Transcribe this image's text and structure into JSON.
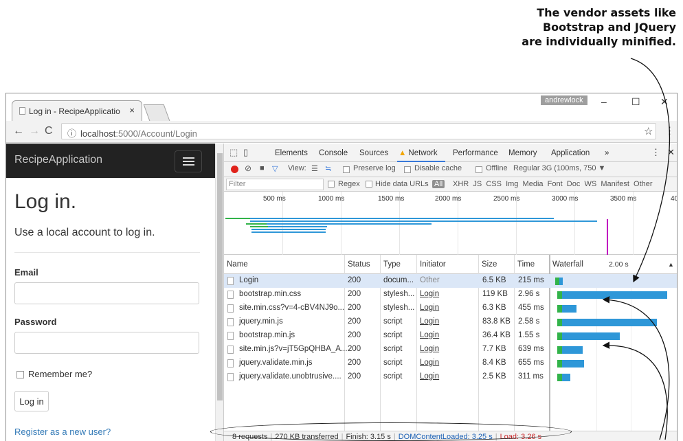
{
  "annotation": {
    "line1": "The vendor assets like",
    "line2": "Bootstrap and JQuery",
    "line3": "are individually minified."
  },
  "browser": {
    "tab_title": "Log in - RecipeApplicatio",
    "tab_close": "×",
    "user_badge": "andrewlock",
    "minimize": "–",
    "maximize": "☐",
    "close": "✕",
    "url_host": "localhost",
    "url_path": ":5000/Account/Login",
    "info_icon": "ⓘ",
    "star_icon": "☆",
    "menu_icon": "⋮"
  },
  "page": {
    "brand": "RecipeApplication",
    "heading": "Log in.",
    "lead": "Use a local account to log in.",
    "email_label": "Email",
    "password_label": "Password",
    "remember_label": "Remember me?",
    "login_button": "Log in",
    "register_link": "Register as a new user?"
  },
  "devtools": {
    "tabs": [
      "Elements",
      "Console",
      "Sources",
      "Network",
      "Performance",
      "Memory",
      "Application"
    ],
    "more_tabs": "»",
    "selected_tab": "Network",
    "view_label": "View:",
    "preserve_log": "Preserve log",
    "disable_cache": "Disable cache",
    "offline": "Offline",
    "throttle": "Regular 3G (100ms, 750",
    "filter_placeholder": "Filter",
    "regex": "Regex",
    "hide_data_urls": "Hide data URLs",
    "all": "All",
    "types": [
      "XHR",
      "JS",
      "CSS",
      "Img",
      "Media",
      "Font",
      "Doc",
      "WS",
      "Manifest",
      "Other"
    ],
    "overview_ticks": [
      "500 ms",
      "1000 ms",
      "1500 ms",
      "2000 ms",
      "2500 ms",
      "3000 ms",
      "3500 ms",
      "40"
    ],
    "columns": [
      "Name",
      "Status",
      "Type",
      "Initiator",
      "Size",
      "Time",
      "Waterfall"
    ],
    "waterfall_time": "2.00 s",
    "rows": [
      {
        "name": "Login",
        "status": "200",
        "type": "docum...",
        "initiator": "Other",
        "size": "6.5 KB",
        "time": "215 ms",
        "wait": 0.01,
        "recv": 0.03
      },
      {
        "name": "bootstrap.min.css",
        "status": "200",
        "type": "stylesh...",
        "initiator": "Login",
        "size": "119 KB",
        "time": "2.96 s",
        "wait": 0.03,
        "recv": 0.85
      },
      {
        "name": "site.min.css?v=4-cBV4NJ9o...",
        "status": "200",
        "type": "stylesh...",
        "initiator": "Login",
        "size": "6.3 KB",
        "time": "455 ms",
        "wait": 0.03,
        "recv": 0.12
      },
      {
        "name": "jquery.min.js",
        "status": "200",
        "type": "script",
        "initiator": "Login",
        "size": "83.8 KB",
        "time": "2.58 s",
        "wait": 0.03,
        "recv": 0.77
      },
      {
        "name": "bootstrap.min.js",
        "status": "200",
        "type": "script",
        "initiator": "Login",
        "size": "36.4 KB",
        "time": "1.55 s",
        "wait": 0.03,
        "recv": 0.47
      },
      {
        "name": "site.min.js?v=jT5GpQHBA_A...",
        "status": "200",
        "type": "script",
        "initiator": "Login",
        "size": "7.7 KB",
        "time": "639 ms",
        "wait": 0.03,
        "recv": 0.17
      },
      {
        "name": "jquery.validate.min.js",
        "status": "200",
        "type": "script",
        "initiator": "Login",
        "size": "8.4 KB",
        "time": "655 ms",
        "wait": 0.03,
        "recv": 0.18
      },
      {
        "name": "jquery.validate.unobtrusive....",
        "status": "200",
        "type": "script",
        "initiator": "Login",
        "size": "2.5 KB",
        "time": "311 ms",
        "wait": 0.03,
        "recv": 0.07
      }
    ],
    "summary": {
      "requests": "8 requests",
      "transferred": "270 KB transferred",
      "finish": "Finish: 3.15 s",
      "dcl": "DOMContentLoaded: 3.25 s",
      "load": "Load: 3.26 s"
    }
  },
  "colors": {
    "wait": "#32b34a",
    "receive": "#2e97d8",
    "navbar": "#222222",
    "link": "#337ab7"
  }
}
